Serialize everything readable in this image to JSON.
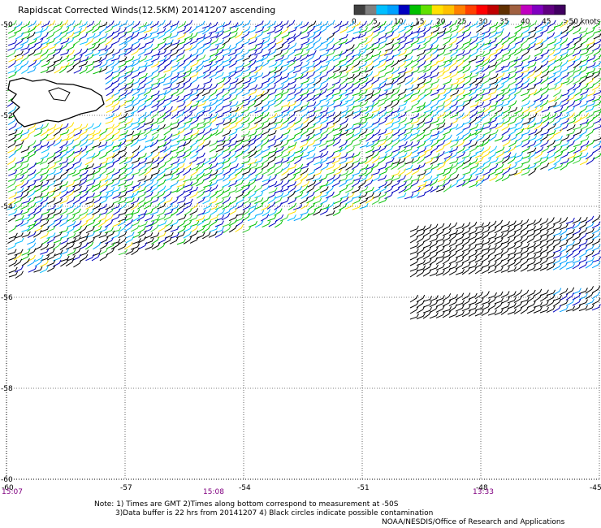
{
  "title": "Rapidscat Corrected Winds(12.5KM) 20141207 ascending",
  "color_scale": {
    "labels": [
      "0",
      "5",
      "10",
      "15",
      "20",
      "25",
      "30",
      "35",
      "40",
      "45",
      ">50 knots"
    ],
    "colors": [
      "#404040",
      "#808080",
      "#00bfff",
      "#00a0ff",
      "#0000c0",
      "#00c000",
      "#60e000",
      "#ffe000",
      "#ffc000",
      "#ff8000",
      "#ff4000",
      "#ff0000",
      "#c00000",
      "#603000",
      "#a06040",
      "#c000c0",
      "#8000c0",
      "#600080",
      "#400060"
    ]
  },
  "axes": {
    "x_labels": [
      "-60",
      "-57",
      "-54",
      "-51",
      "-48",
      "-45"
    ],
    "y_labels": [
      "-50",
      "-52",
      "-54",
      "-56",
      "-58",
      "-60"
    ],
    "xlim": [
      -60,
      -45
    ],
    "ylim": [
      -60,
      -50
    ]
  },
  "times": [
    "15:07",
    "15:08",
    "13:33"
  ],
  "notes": {
    "line1": "Note: 1) Times are GMT 2)Times along bottom correspond to measurement at -50S",
    "line2": "3)Data buffer is 22 hrs from 20141207 4) Black circles indicate possible contamination",
    "line3": "NOAA/NESDIS/Office of Research and Applications"
  }
}
